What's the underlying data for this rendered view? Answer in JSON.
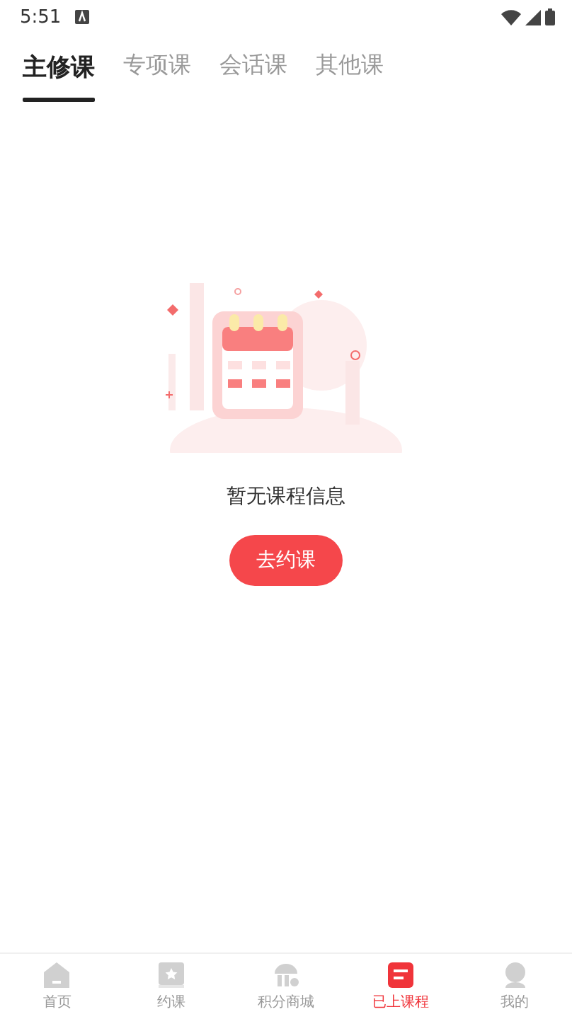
{
  "status_bar": {
    "time": "5:51"
  },
  "tabs": [
    {
      "label": "主修课",
      "selected": true
    },
    {
      "label": "专项课",
      "selected": false
    },
    {
      "label": "会话课",
      "selected": false
    },
    {
      "label": "其他课",
      "selected": false
    }
  ],
  "empty_state": {
    "message": "暂无课程信息",
    "button": "去约课"
  },
  "bottom_nav": [
    {
      "kind": "home",
      "label": "首页",
      "selected": false
    },
    {
      "kind": "star",
      "label": "约课",
      "selected": false
    },
    {
      "kind": "shop",
      "label": "积分商城",
      "selected": false
    },
    {
      "kind": "course",
      "label": "已上课程",
      "selected": true
    },
    {
      "kind": "profile",
      "label": "我的",
      "selected": false
    }
  ]
}
